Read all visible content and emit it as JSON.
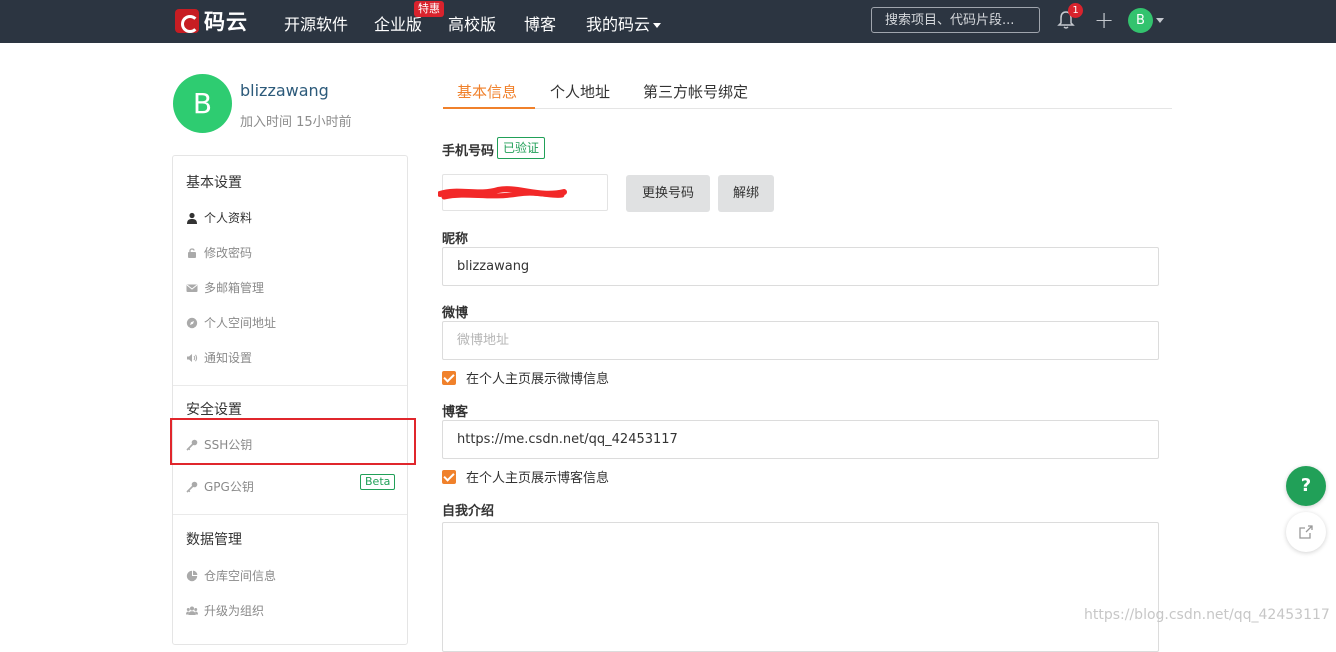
{
  "nav": {
    "logo_text": "码云",
    "items": [
      "开源软件",
      "企业版",
      "高校版",
      "博客",
      "我的码云"
    ],
    "enterprise_badge": "特惠",
    "search_placeholder": "搜索项目、代码片段...",
    "notification_count": "1",
    "avatar_letter": "B"
  },
  "profile": {
    "avatar_letter": "B",
    "username": "blizzawang",
    "joined": "加入时间 15小时前"
  },
  "sidebar": {
    "sections": [
      {
        "title": "基本设置",
        "items": [
          {
            "label": "个人资料",
            "icon": "user-icon",
            "active": true
          },
          {
            "label": "修改密码",
            "icon": "lock-icon"
          },
          {
            "label": "多邮箱管理",
            "icon": "envelope-icon"
          },
          {
            "label": "个人空间地址",
            "icon": "compass-icon"
          },
          {
            "label": "通知设置",
            "icon": "volume-icon"
          }
        ]
      },
      {
        "title": "安全设置",
        "items": [
          {
            "label": "SSH公钥",
            "icon": "key-icon"
          },
          {
            "label": "GPG公钥",
            "icon": "key-icon",
            "badge": "Beta"
          }
        ]
      },
      {
        "title": "数据管理",
        "items": [
          {
            "label": "仓库空间信息",
            "icon": "pie-chart-icon"
          },
          {
            "label": "升级为组织",
            "icon": "users-icon"
          }
        ]
      }
    ]
  },
  "tabs": [
    "基本信息",
    "个人地址",
    "第三方帐号绑定"
  ],
  "form": {
    "phone_label": "手机号码",
    "verified": "已验证",
    "change_number": "更换号码",
    "unbind": "解绑",
    "nickname_label": "昵称",
    "nickname_value": "blizzawang",
    "weibo_label": "微博",
    "weibo_placeholder": "微博地址",
    "weibo_show": "在个人主页展示微博信息",
    "blog_label": "博客",
    "blog_value": "https://me.csdn.net/qq_42453117",
    "blog_show": "在个人主页展示博客信息",
    "intro_label": "自我介绍"
  },
  "help_label": "?",
  "watermark": "https://blog.csdn.net/qq_42453117",
  "colors": {
    "nav_bg": "#2c3541",
    "accent": "#f0812b",
    "green": "#21a058",
    "highlight": "#e0262c"
  }
}
